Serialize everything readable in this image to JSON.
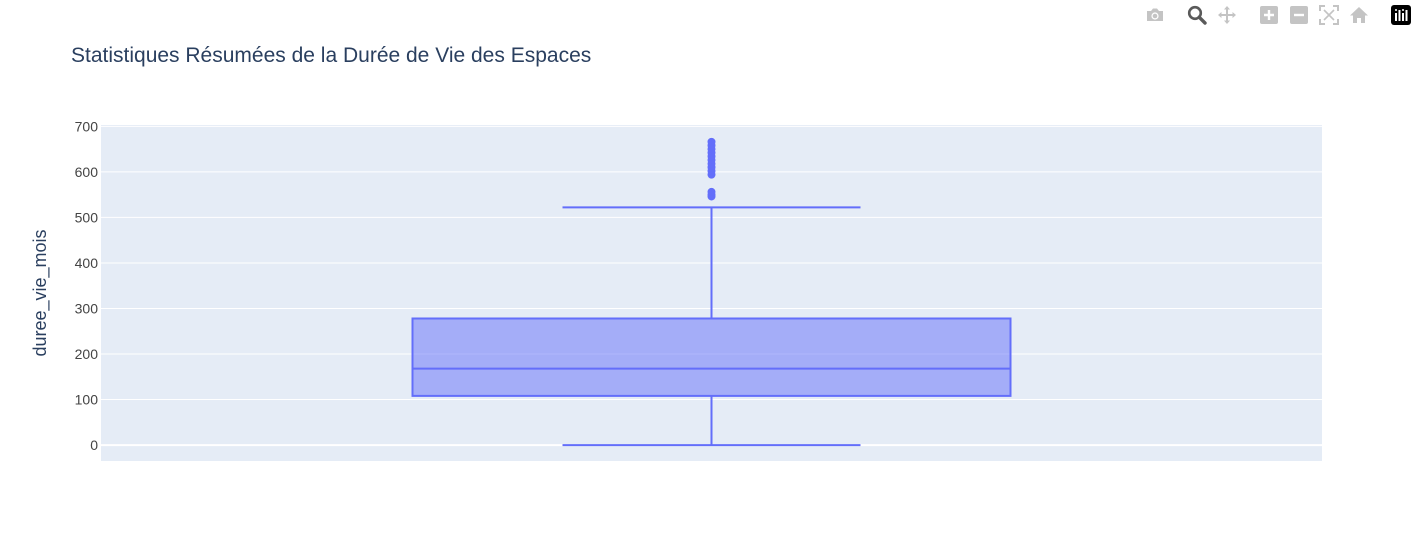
{
  "toolbar": {
    "icons": [
      "camera-icon",
      "zoom-icon",
      "pan-icon",
      "zoom-in-icon",
      "zoom-out-icon",
      "autoscale-icon",
      "home-icon",
      "plotly-logo-icon"
    ]
  },
  "chart_data": {
    "type": "box",
    "title": "Statistiques Résumées de la Durée de Vie des Espaces",
    "xlabel": "",
    "ylabel": "duree_vie_mois",
    "ylim": [
      -35,
      703
    ],
    "yticks": [
      0,
      100,
      200,
      300,
      400,
      500,
      600,
      700
    ],
    "grid": true,
    "legend": "none",
    "colors": {
      "box": "#636efa",
      "plot_bg": "#e5ecf6",
      "text": "#2a3f5f"
    },
    "box": {
      "min": 0,
      "q1": 108,
      "median": 168,
      "q3": 278,
      "upper_fence": 522,
      "outliers": [
        546,
        550,
        556,
        594,
        602,
        610,
        618,
        626,
        634,
        642,
        650,
        658,
        666
      ]
    }
  }
}
